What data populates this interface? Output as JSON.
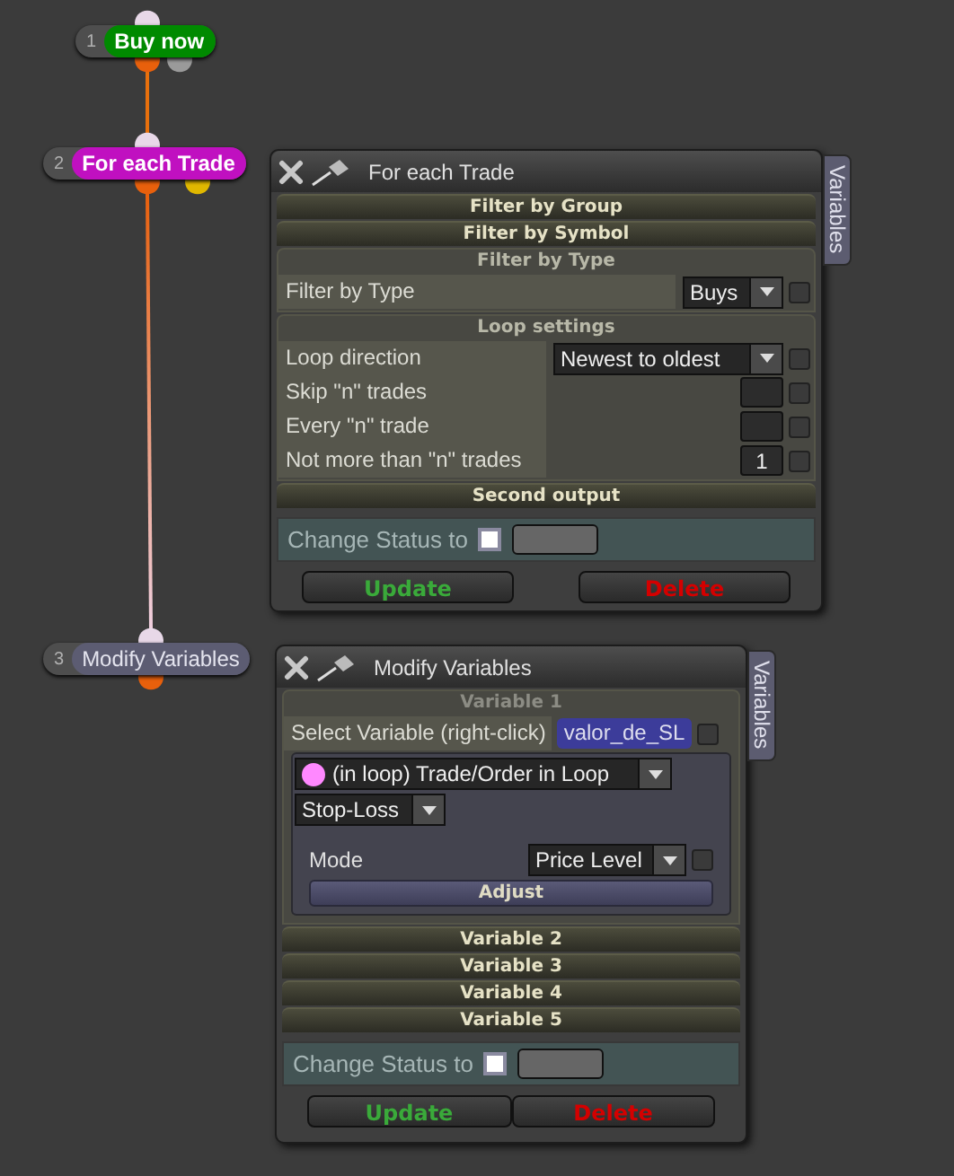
{
  "nodes": [
    {
      "number": "1",
      "label": "Buy now",
      "color": "#008a00",
      "outputs": [
        {
          "color": "#e8600c"
        },
        {
          "color": "#9a9a9a"
        }
      ]
    },
    {
      "number": "2",
      "label": "For each Trade",
      "color": "#c010c0",
      "outputs": [
        {
          "color": "#e8600c"
        },
        {
          "color": "#e0b800"
        }
      ]
    },
    {
      "number": "3",
      "label": "Modify Variables",
      "color": "#5c5c72",
      "outputs": [
        {
          "color": "#e8600c"
        }
      ]
    }
  ],
  "panels": [
    {
      "title": "For each Trade",
      "side_tab": "Variables",
      "items": [
        {
          "kind": "bar",
          "label": "Filter by Group"
        },
        {
          "kind": "bar",
          "label": "Filter by Symbol"
        },
        {
          "kind": "group",
          "title": "Filter by Type",
          "rows": [
            {
              "kind": "select",
              "label": "Filter by Type",
              "value": "Buys",
              "checked": false
            }
          ]
        },
        {
          "kind": "group",
          "title": "Loop settings",
          "rows": [
            {
              "kind": "select",
              "label": "Loop direction",
              "value": "Newest to oldest",
              "checked": false
            },
            {
              "kind": "input",
              "label": "Skip \"n\" trades",
              "checked": false
            },
            {
              "kind": "input",
              "label": "Every \"n\" trade",
              "checked": false
            },
            {
              "kind": "input",
              "label": "Not more than \"n\" trades",
              "value": "1",
              "checked": false
            }
          ]
        },
        {
          "kind": "bar",
          "label": "Second output"
        }
      ],
      "status": {
        "label": "Change Status to",
        "checked": false
      },
      "buttons": [
        {
          "kind": "update",
          "label": "Update"
        },
        {
          "kind": "delete",
          "label": "Delete"
        }
      ]
    },
    {
      "title": "Modify Variables",
      "side_tab": "Variables",
      "items": [
        {
          "kind": "variable",
          "title": "Variable 1",
          "select_label": "Select Variable (right-click)",
          "variable": "valor_de_SL",
          "checked": false,
          "source": {
            "label": "(in loop) Trade/Order in Loop",
            "color": "#ff88ff"
          },
          "property": "Stop-Loss",
          "mode_label": "Mode",
          "mode_value": "Price Level",
          "mode_checked": false,
          "adjust": "Adjust"
        },
        {
          "kind": "bar",
          "label": "Variable 2"
        },
        {
          "kind": "bar",
          "label": "Variable 3"
        },
        {
          "kind": "bar",
          "label": "Variable 4"
        },
        {
          "kind": "bar",
          "label": "Variable 5"
        }
      ],
      "status": {
        "label": "Change Status to",
        "checked": false
      },
      "buttons": [
        {
          "kind": "update",
          "label": "Update"
        },
        {
          "kind": "delete",
          "label": "Delete"
        }
      ]
    }
  ]
}
